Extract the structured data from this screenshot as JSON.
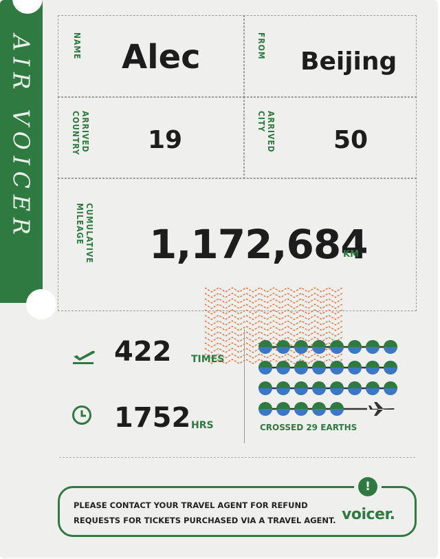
{
  "stub": {
    "title": "AIR VOICER"
  },
  "name": {
    "label": "NAME",
    "value": "Alec"
  },
  "from": {
    "label": "FROM",
    "value": "Beijing"
  },
  "arrived_country": {
    "label": "ARRIVED\nCOUNTRY",
    "value": "19"
  },
  "arrived_city": {
    "label": "ARRIVED\nCITY",
    "value": "50"
  },
  "mileage": {
    "label": "CUMULATIVE\nMILEAGE",
    "value": "1,172,684",
    "unit": "KM"
  },
  "flights": {
    "icon": "airplane-takeoff-icon",
    "value": "422",
    "unit": "TIMES"
  },
  "hours": {
    "icon": "clock-icon",
    "value": "1752",
    "unit": "HRS"
  },
  "earths": {
    "label": "CROSSED 29 EARTHS",
    "count": 29,
    "per_row": 8
  },
  "notice": {
    "line1": "PLEASE CONTACT YOUR TRAVEL AGENT FOR REFUND",
    "line2": "REQUESTS FOR TICKETS PURCHASED VIA A TRAVEL AGENT.",
    "alert_mark": "!"
  },
  "brand": {
    "name": "voicer."
  },
  "colors": {
    "green": "#2e7a40",
    "orange": "#e8743c",
    "globe_blue": "#3a78c2",
    "paper": "#efefed"
  }
}
